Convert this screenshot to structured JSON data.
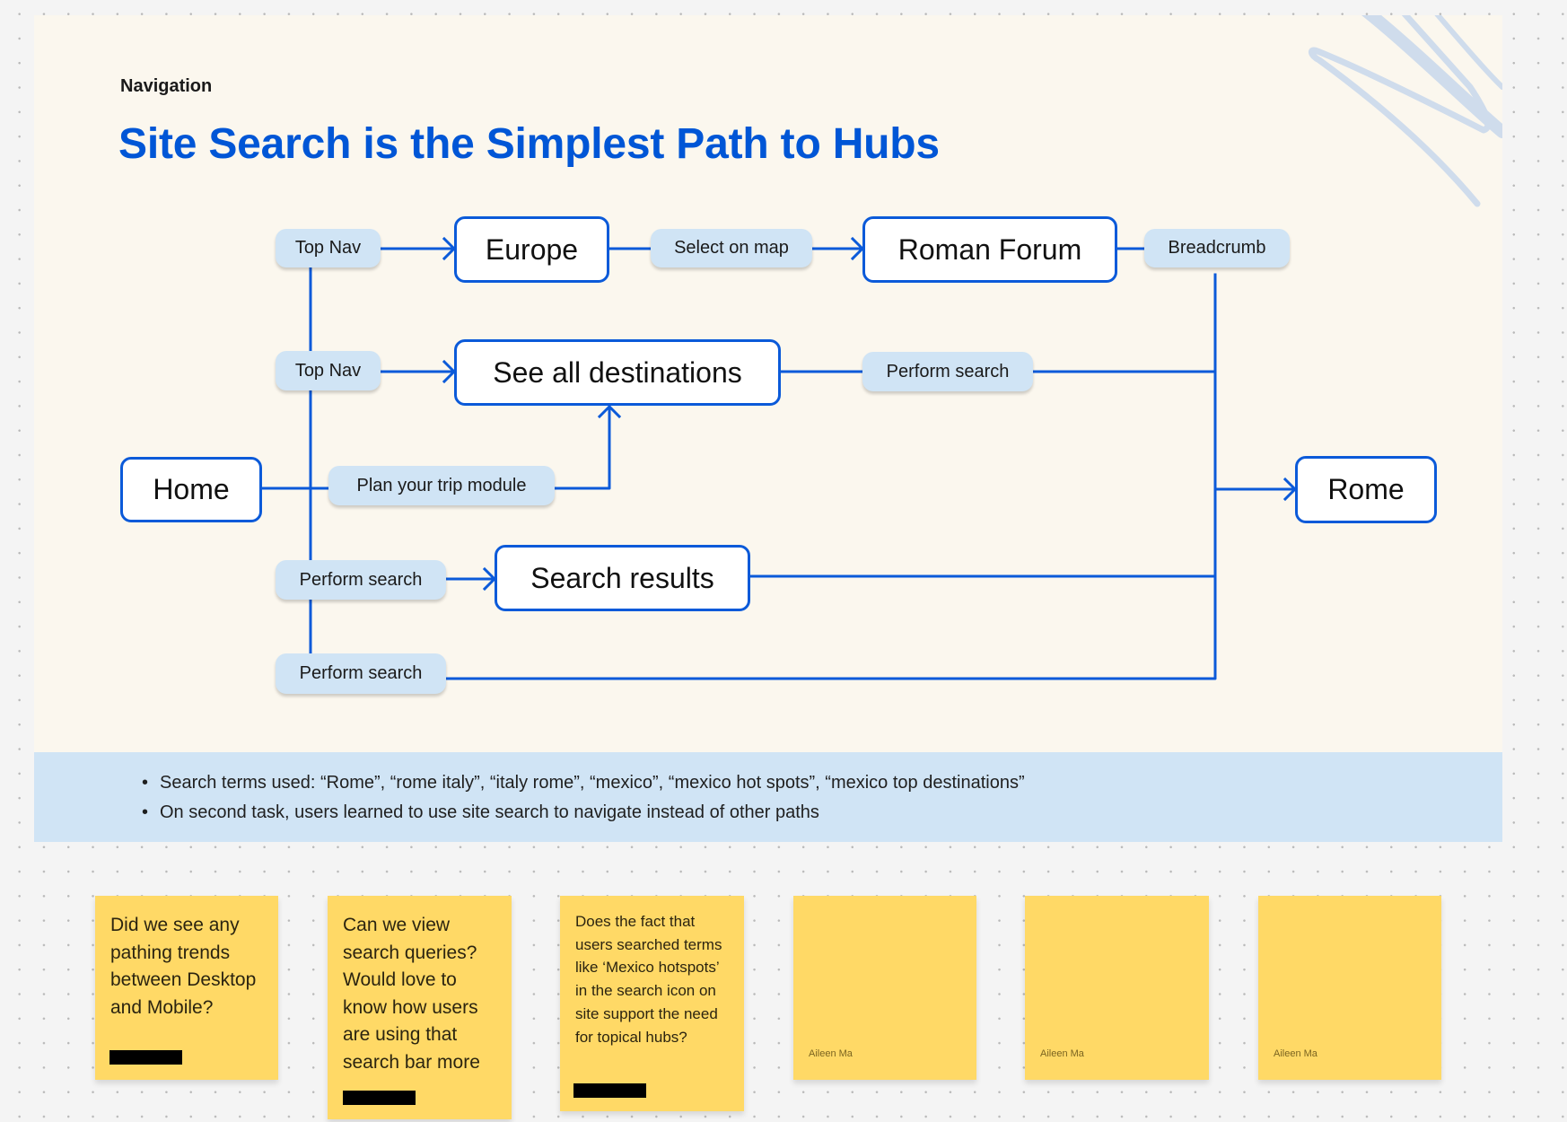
{
  "header": {
    "eyebrow": "Navigation",
    "title": "Site Search is the Simplest Path to Hubs"
  },
  "colors": {
    "accent": "#0056d6",
    "line": "#0b5ad9",
    "pill": "#d0e4f5",
    "panel": "#fbf7ee",
    "sticky": "#ffd966",
    "scribble": "#cfdcec"
  },
  "diagram": {
    "nodes": {
      "home": "Home",
      "europe": "Europe",
      "roman_forum": "Roman Forum",
      "see_all": "See all destinations",
      "search_results": "Search results",
      "rome": "Rome"
    },
    "edges": {
      "top_nav_1": "Top Nav",
      "top_nav_2": "Top Nav",
      "select_on_map": "Select on map",
      "breadcrumb": "Breadcrumb",
      "perform_search_right": "Perform search",
      "plan_trip": "Plan your trip module",
      "perform_search_3": "Perform search",
      "perform_search_4": "Perform search"
    }
  },
  "notes_band": {
    "bullets": [
      "Search terms used: “Rome”, “rome italy”, “italy rome”, “mexico”, “mexico hot spots”, “mexico top destinations”",
      "On second task, users learned to use site search to navigate instead of other paths"
    ]
  },
  "stickies": [
    {
      "text": "Did we see any pathing trends between Desktop and Mobile?",
      "author": ""
    },
    {
      "text": "Can we view search queries? Would love to know how users are using that search bar more",
      "author": ""
    },
    {
      "text": "Does the fact that users searched terms like ‘Mexico hotspots’ in the search icon on site support the need for topical hubs?",
      "author": ""
    },
    {
      "text": "",
      "author": "Aileen Ma"
    },
    {
      "text": "",
      "author": "Aileen Ma"
    },
    {
      "text": "",
      "author": "Aileen Ma"
    }
  ]
}
